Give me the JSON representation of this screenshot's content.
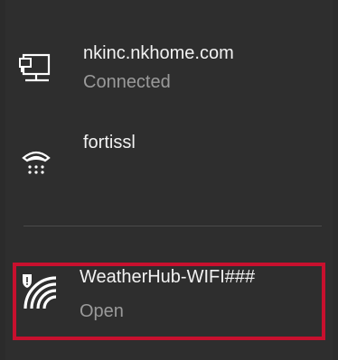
{
  "networks": [
    {
      "name": "nkinc.nkhome.com",
      "status": "Connected",
      "icon": "ethernet-icon"
    },
    {
      "name": "fortissl",
      "status": "",
      "icon": "dial-up-icon"
    },
    {
      "name": "WeatherHub-WIFI###",
      "status": "Open",
      "icon": "wifi-unsecured-icon"
    }
  ],
  "colors": {
    "background": "#2e2e2e",
    "text": "#f2f2f2",
    "secondary_text": "#9a9a9a",
    "highlight": "#c8102e"
  }
}
